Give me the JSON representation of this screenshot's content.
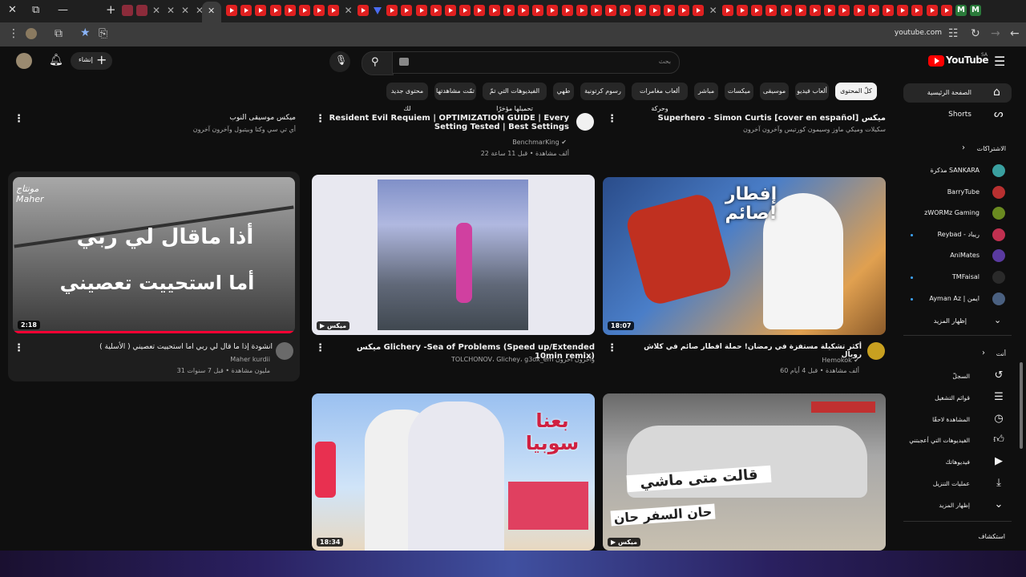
{
  "browser": {
    "url": "youtube.com"
  },
  "header": {
    "logo": "YouTube",
    "logo_region": "SA",
    "search_placeholder": "بحث",
    "create_label": "إنشاء"
  },
  "chips": [
    {
      "label": "كلّ المحتوى",
      "active": true
    },
    {
      "label": "ألعاب فيديو"
    },
    {
      "label": "موسيقى"
    },
    {
      "label": "ميكسات"
    },
    {
      "label": "مباشر"
    },
    {
      "label": "ألعاب مغامرات وحركة"
    },
    {
      "label": "رسوم كرتونية"
    },
    {
      "label": "طهي"
    },
    {
      "label": "الفيديوهات التي تمّ تحميلها مؤخرًا"
    },
    {
      "label": "تمّت مشاهدتها"
    },
    {
      "label": "محتوى جديد لك"
    }
  ],
  "sidebar": {
    "home": "الصفحة الرئيسية",
    "shorts": "Shorts",
    "subscriptions_header": "الاشتراكات",
    "subscriptions": [
      {
        "name": "مذكرة SANKARA",
        "color": "#3aa0a0"
      },
      {
        "name": "BarryTube",
        "color": "#b83030"
      },
      {
        "name": "zWORMz Gaming",
        "color": "#6a8a20"
      },
      {
        "name": "Reybad - ريباد",
        "color": "#c03050",
        "dot": true
      },
      {
        "name": "AniMates",
        "color": "#5a3aa0"
      },
      {
        "name": "TMFaisal",
        "color": "#2a2a2a",
        "dot": true
      },
      {
        "name": "Ayman Az | ايمن",
        "color": "#4a6080",
        "dot": true
      }
    ],
    "show_more": "إظهار المزيد",
    "you_header": "أنت",
    "you_items": [
      {
        "label": "السجلّ",
        "icon": "history-icon"
      },
      {
        "label": "قوائم التشغيل",
        "icon": "playlists-icon"
      },
      {
        "label": "المشاهدة لاحقًا",
        "icon": "watch-later-icon"
      },
      {
        "label": "الفيديوهات التي أعجبتني",
        "icon": "liked-icon"
      },
      {
        "label": "فيديوهاتك",
        "icon": "your-videos-icon"
      },
      {
        "label": "عمليات التنزيل",
        "icon": "downloads-icon"
      },
      {
        "label": "إظهار المزيد",
        "icon": "chevron-down-icon"
      }
    ],
    "explore_header": "استكشاف"
  },
  "top_row": [
    {
      "title": "ميكس [Superhero - Simon Curtis [cover en español",
      "channel": "سكيلات وميكي ماوز وسيمون كورتيس وآخرون آخرون"
    },
    {
      "title": "Resident Evil Requiem | OPTIMIZATION GUIDE | Every Setting Tested | Best Settings",
      "channel": "BenchmarKing",
      "meta": "22 ألف مشاهدة • قبل 11 ساعة"
    },
    {
      "title": "ميكس موسيقى النوب",
      "channel": "أي تي سي وكتا وبيتبول وآخرون آخرون"
    }
  ],
  "videos": [
    {
      "title": "أكثر تشكيلة مستفزة في رمضان! حملة افطار صائم في كلاش رويال",
      "channel": "Hemokok",
      "meta": "60 ألف مشاهدة • قبل 4 أيام",
      "duration": "18:07",
      "thumb_text": "إفطار صائم!"
    },
    {
      "title": "ميكس Glichery -Sea of Problems (Speed up/Extended 10min remix)",
      "channel": "TOLCHONOV، Glichey، g3ox_em وآخرون آخرون",
      "badge": "ميكس"
    },
    {
      "title": "انشودة إذا ما قال لي ربي اما استحييت تعصيني ( الأسلية )",
      "channel": "Maher kurdii",
      "meta": "31 مليون مشاهدة • قبل 7 سنوات",
      "duration": "2:18",
      "thumb_text_1": "أذا ماقال لي ربي",
      "thumb_text_2": "أما استحييت تعصيني",
      "thumb_corner": "مونتاج Maher"
    },
    {
      "duration": "",
      "badge": "ميكس",
      "thumb_text_1": "قالت متى ماشي",
      "thumb_text_2": "حان السفر حان"
    },
    {
      "duration": "18:34",
      "thumb_text": "بعنا سوبيا"
    }
  ]
}
